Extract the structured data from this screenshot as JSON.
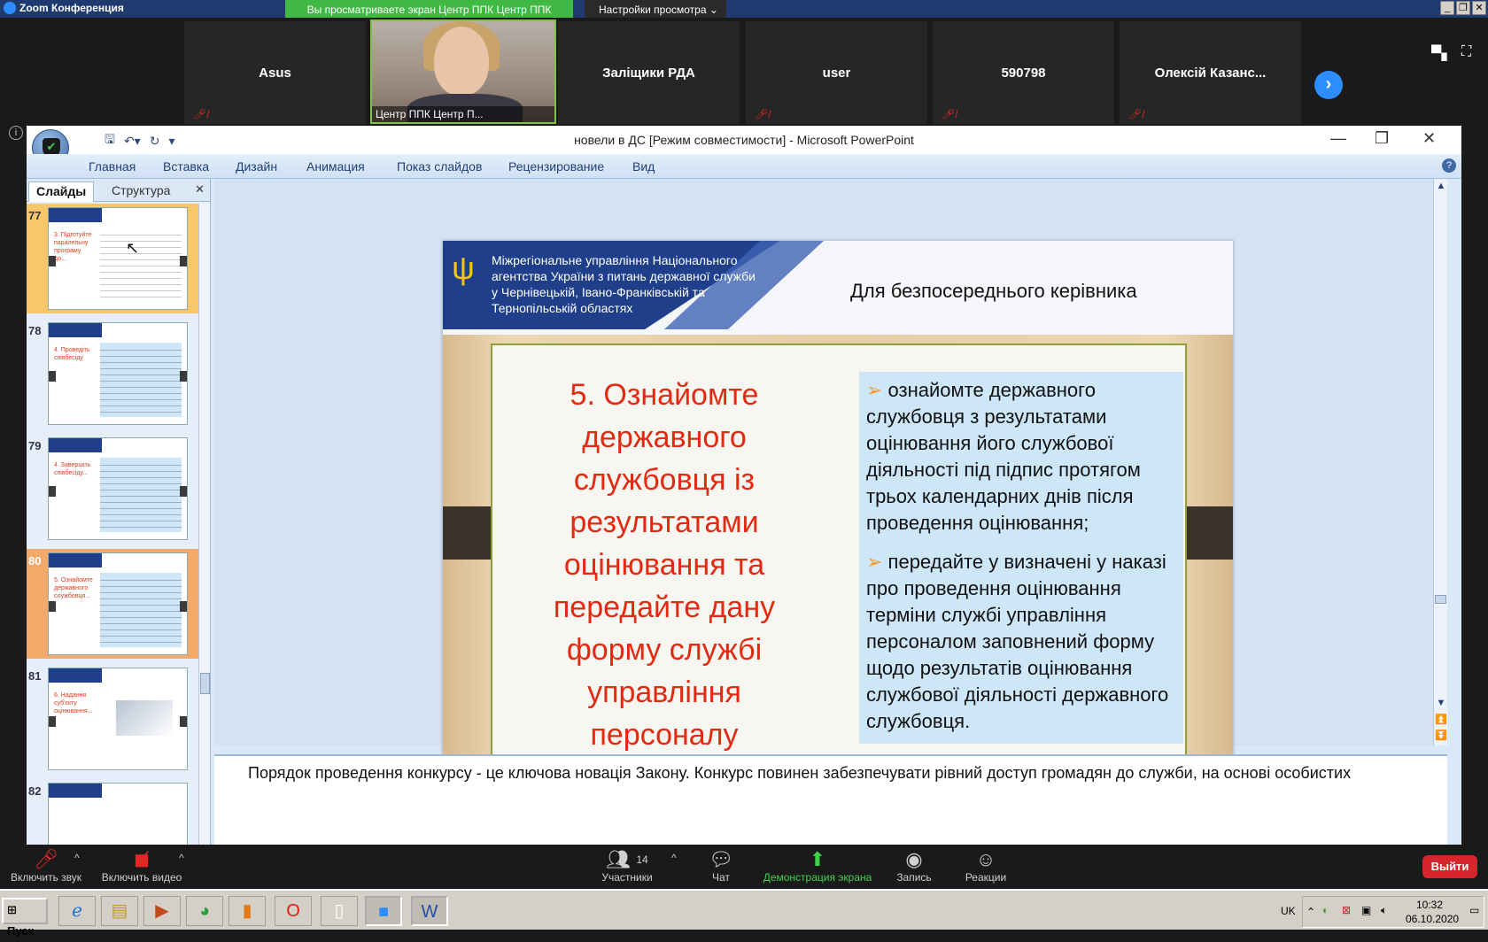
{
  "zoom": {
    "app_title": "Zoom Конференция",
    "share_banner": "Вы просматриваете экран Центр ППК Центр ППК",
    "view_options": "Настройки просмотра",
    "participants": [
      {
        "name": "Asus"
      },
      {
        "name": "Центр ППК Центр П..."
      },
      {
        "name": "Заліщики РДА"
      },
      {
        "name": "user"
      },
      {
        "name": "590798"
      },
      {
        "name": "Олексій Казанс..."
      }
    ],
    "controls": {
      "audio": "Включить звук",
      "video": "Включить видео",
      "participants": "Участники",
      "participants_count": "14",
      "chat": "Чат",
      "share": "Демонстрация экрана",
      "record": "Запись",
      "reactions": "Реакции",
      "leave": "Выйти"
    }
  },
  "powerpoint": {
    "window_title": "новели в ДС [Режим совместимости] - Microsoft PowerPoint",
    "ribbon_tabs": [
      "Главная",
      "Вставка",
      "Дизайн",
      "Анимация",
      "Показ слайдов",
      "Рецензирование",
      "Вид"
    ],
    "panel_tabs": {
      "slides": "Слайды",
      "structure": "Структура"
    },
    "thumbnails": [
      {
        "num": "77",
        "red_text": "3. Підготуйте паралельну програму до..."
      },
      {
        "num": "78",
        "red_text": "4. Проведіть співбесіду"
      },
      {
        "num": "79",
        "red_text": "4. Завершіть співбесіду..."
      },
      {
        "num": "80",
        "red_text": "5. Ознайомте державного службовця..."
      },
      {
        "num": "81",
        "red_text": "6. Надання суб'єкту оцінювання..."
      },
      {
        "num": "82",
        "red_text": ""
      }
    ],
    "slide": {
      "ministry": "Міжрегіональне управління Національного агентства України з питань державної служби у Чернівецькій, Івано-Франківській та Тернопільській областях",
      "audience": "Для безпосереднього керівника",
      "heading": "5. Ознайомте державного службовця із результатами оцінювання та передайте дану форму службі управління персоналу",
      "bullets": [
        "ознайомте державного службовця з результатами оцінювання його службової діяльності під підпис протягом трьох календарних днів після проведення оцінювання;",
        "передайте у визначені у наказі про проведення оцінювання терміни службі управління персоналом заповнений форму щодо результатів оцінювання службової діяльності державного службовця."
      ]
    },
    "notes": "Порядок проведення конкурсу - це ключова новація Закону. Конкурс повинен забезпечувати рівний доступ громадян до служби, на основі особистих"
  },
  "taskbar": {
    "start": "Пуск",
    "lang": "UK",
    "time": "10:32",
    "date": "06.10.2020"
  }
}
